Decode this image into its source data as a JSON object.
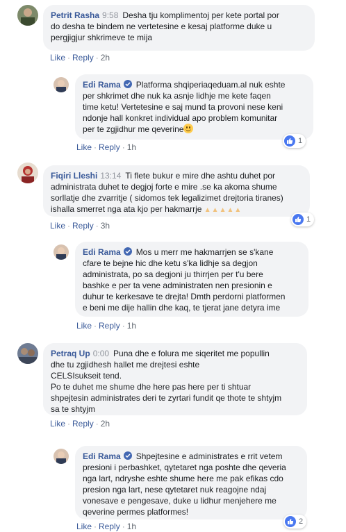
{
  "actions": {
    "like": "Like",
    "reply": "Reply",
    "sep": "·"
  },
  "colors": {
    "link": "#385898",
    "bubble": "#f2f3f5",
    "verified": "#4267b2",
    "like_badge": "#4a78f0"
  },
  "comments": [
    {
      "author": "Petrit Rasha",
      "time": "9:58",
      "lines": [
        "Desha tju komplimentoj per kete portal por",
        "do desha te bindem ne vertetesine e kesaj platforme duke u",
        "pergjigjur shkrimeve te mija"
      ],
      "age": "2h"
    },
    {
      "author": "Edi Rama",
      "verified": true,
      "lines": [
        "Platforma shqiperiaqeduam.al nuk eshte",
        "per shkrimet dhe nuk ka asnje lidhje me kete faqen",
        "time ketu! Vertetesine e saj mund ta provoni nese keni",
        "ndonje hall konkret individual apo problem komunitar",
        "per te zgjidhur me qeverine"
      ],
      "emoji": "smiling-face-icon",
      "age": "1h",
      "reactions": "1"
    },
    {
      "author": "Fiqiri Lleshi",
      "time": "13:14",
      "lines": [
        "Ti flete bukur e mire dhe ashtu duhet por",
        "administrata duhet te degjoj forte e mire .se ka akoma shume",
        "sorllatje dhe zvarritje ( sidomos tek legalizimet drejtoria tiranes)",
        "ishalla smerret nga ata kjo per hakmarrje"
      ],
      "emoji": "praying-hands-icon",
      "age": "3h",
      "reactions": "1"
    },
    {
      "author": "Edi Rama",
      "verified": true,
      "lines": [
        "Mos u merr me hakmarrjen se s'kane",
        "cfare te bejne hic dhe ketu s'ka lidhje sa degjon",
        "administrata, po sa degjoni ju thirrjen per t'u bere",
        "bashke e per ta vene administraten nen presionin e",
        "duhur te kerkesave te drejta! Dmth perdorni platformen",
        "e beni me dije hallin dhe kaq, te tjerat jane detyra ime"
      ],
      "age": "1h"
    },
    {
      "author": "Petraq Up",
      "time": "0:00",
      "lines": [
        "Puna dhe e folura me siqeritet me popullin",
        "dhe tu zgjidhesh hallet me drejtesi eshte",
        "CELSIsukseit tend.",
        "Po te duhet me shume dhe here pas here per ti shtuar",
        "shpejtesin administrates deri te zyrtari fundit qe thote te shtyjm",
        "sa te shtyjm"
      ],
      "age": "2h"
    },
    {
      "author": "Edi Rama",
      "verified": true,
      "lines": [
        "Shpejtesine e administrates e rrit vetem",
        "presioni i perbashket, qytetaret nga poshte dhe qeveria",
        "nga lart, ndryshe eshte shume here me pak efikas cdo",
        "presion nga lart, nese qytetaret nuk reagojne ndaj",
        "vonesave e pengesave, duke u lidhur menjehere me",
        "qeverine permes platformes!"
      ],
      "age": "1h",
      "reactions": "2"
    }
  ]
}
